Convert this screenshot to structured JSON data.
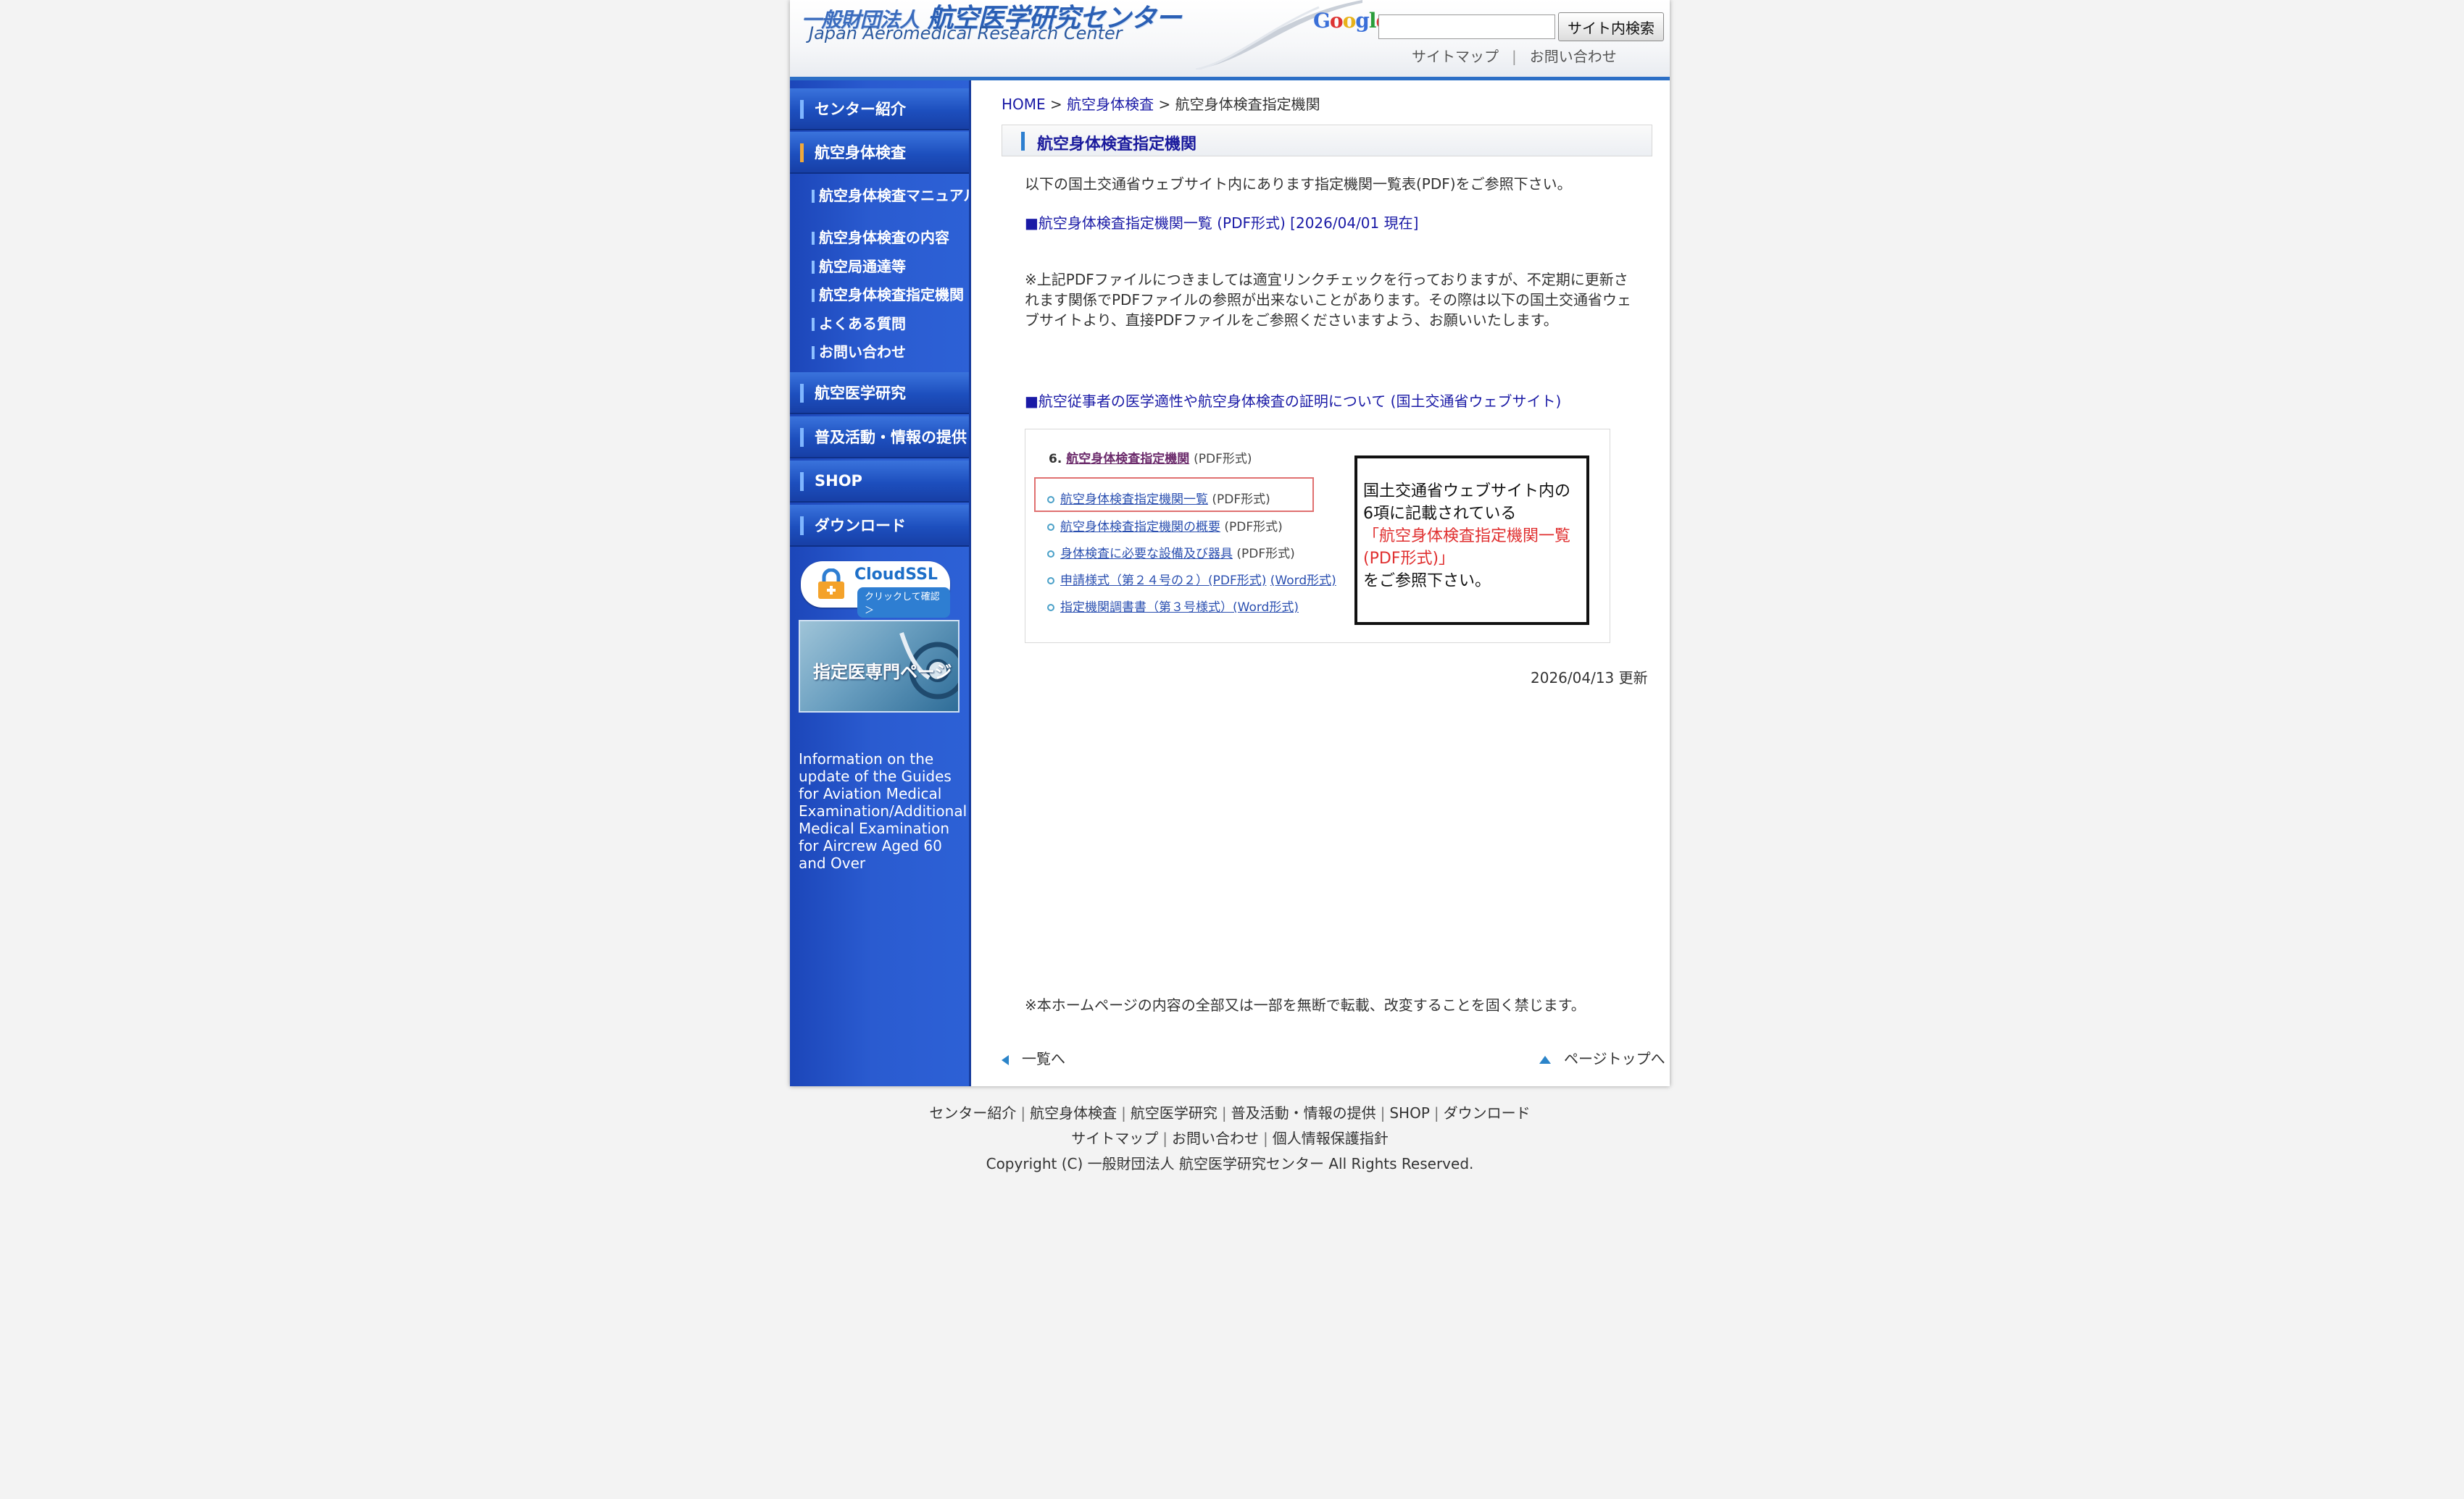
{
  "header": {
    "logo_jp_prefix": "一般財団法人",
    "logo_jp_name": "航空医学研究センター",
    "logo_en": "Japan Aeromedical Research Center",
    "google_mark": "Google",
    "search_placeholder": "",
    "search_button": "サイト内検索",
    "util_links": [
      "サイトマップ",
      "お問い合わせ"
    ]
  },
  "sidebar": {
    "nav": [
      "センター紹介",
      "航空身体検査",
      "航空医学研究",
      "普及活動・情報の提供",
      "SHOP",
      "ダウンロード"
    ],
    "sub": [
      "航空身体検査マニュアル",
      "航空身体検査の内容",
      "航空局通達等",
      "航空身体検査指定機関",
      "よくある質問",
      "お問い合わせ"
    ],
    "ssl_title": "CloudSSL",
    "ssl_sub": "クリックして確認 ＞",
    "doctor_banner": "指定医専門ページ",
    "info_text": "Information on the update of the Guides for Aviation Medical Examination/Additional Medical Examination for Aircrew Aged 60 and Over"
  },
  "breadcrumb": {
    "home": "HOME",
    "sep": ">",
    "parent": "航空身体検査",
    "current": "航空身体検査指定機関"
  },
  "main": {
    "title": "航空身体検査指定機関",
    "intro": "以下の国土交通省ウェブサイト内にあります指定機関一覧表(PDF)をご参照下さい。",
    "pdf_link": "■航空身体検査指定機関一覧 (PDF形式) [2026/04/01 現在]",
    "notice": "※上記PDFファイルにつきましては適宜リンクチェックを行っておりますが、不定期に更新されます関係でPDFファイルの参照が出来ないことがあります。その際は以下の国土交通省ウェブサイトより、直接PDFファイルをご参照くださいますよう、お願いいたします。",
    "mlit_link": "■航空従事者の医学適性や航空身体検査の証明について (国土交通省ウェブサイト)",
    "screenshot": {
      "heading_num": "6.",
      "heading_link": "航空身体検査指定機関",
      "heading_suffix": "(PDF形式)",
      "items": [
        {
          "link": "航空身体検査指定機関一覧",
          "suffix": "(PDF形式)"
        },
        {
          "link": "航空身体検査指定機関の概要",
          "suffix": "(PDF形式)"
        },
        {
          "link": "身体検査に必要な設備及び器具",
          "suffix": "(PDF形式)"
        },
        {
          "link": "申請様式（第２４号の２）(PDF形式)",
          "suffix": "(Word形式)"
        },
        {
          "link": "指定機関調書書（第３号様式）(Word形式)",
          "suffix": ""
        }
      ],
      "callout_line1": "国土交通省ウェブサイト内の",
      "callout_line2": "6項に記載されている",
      "callout_red1": "「航空身体検査指定機関一覧",
      "callout_red2": "(PDF形式)」",
      "callout_line3": "をご参照下さい。"
    },
    "updated": "2026/04/13 更新",
    "copy_note": "※本ホームページの内容の全部又は一部を無断で転載、改変することを固く禁じます。",
    "back_label": "一覧へ",
    "top_label": "ページトップへ"
  },
  "footer": {
    "row1": [
      "センター紹介",
      "航空身体検査",
      "航空医学研究",
      "普及活動・情報の提供",
      "SHOP",
      "ダウンロード"
    ],
    "row2": [
      "サイトマップ",
      "お問い合わせ",
      "個人情報保護指針"
    ],
    "copyright": "Copyright (C) 一般財団法人 航空医学研究センター All Rights Reserved."
  },
  "colors": {
    "sidebar_blue": "#2a5bd0",
    "link_blue": "#1a1aa6",
    "header_rule": "#2c6fc6",
    "accent_orange": "#f1a93a"
  }
}
